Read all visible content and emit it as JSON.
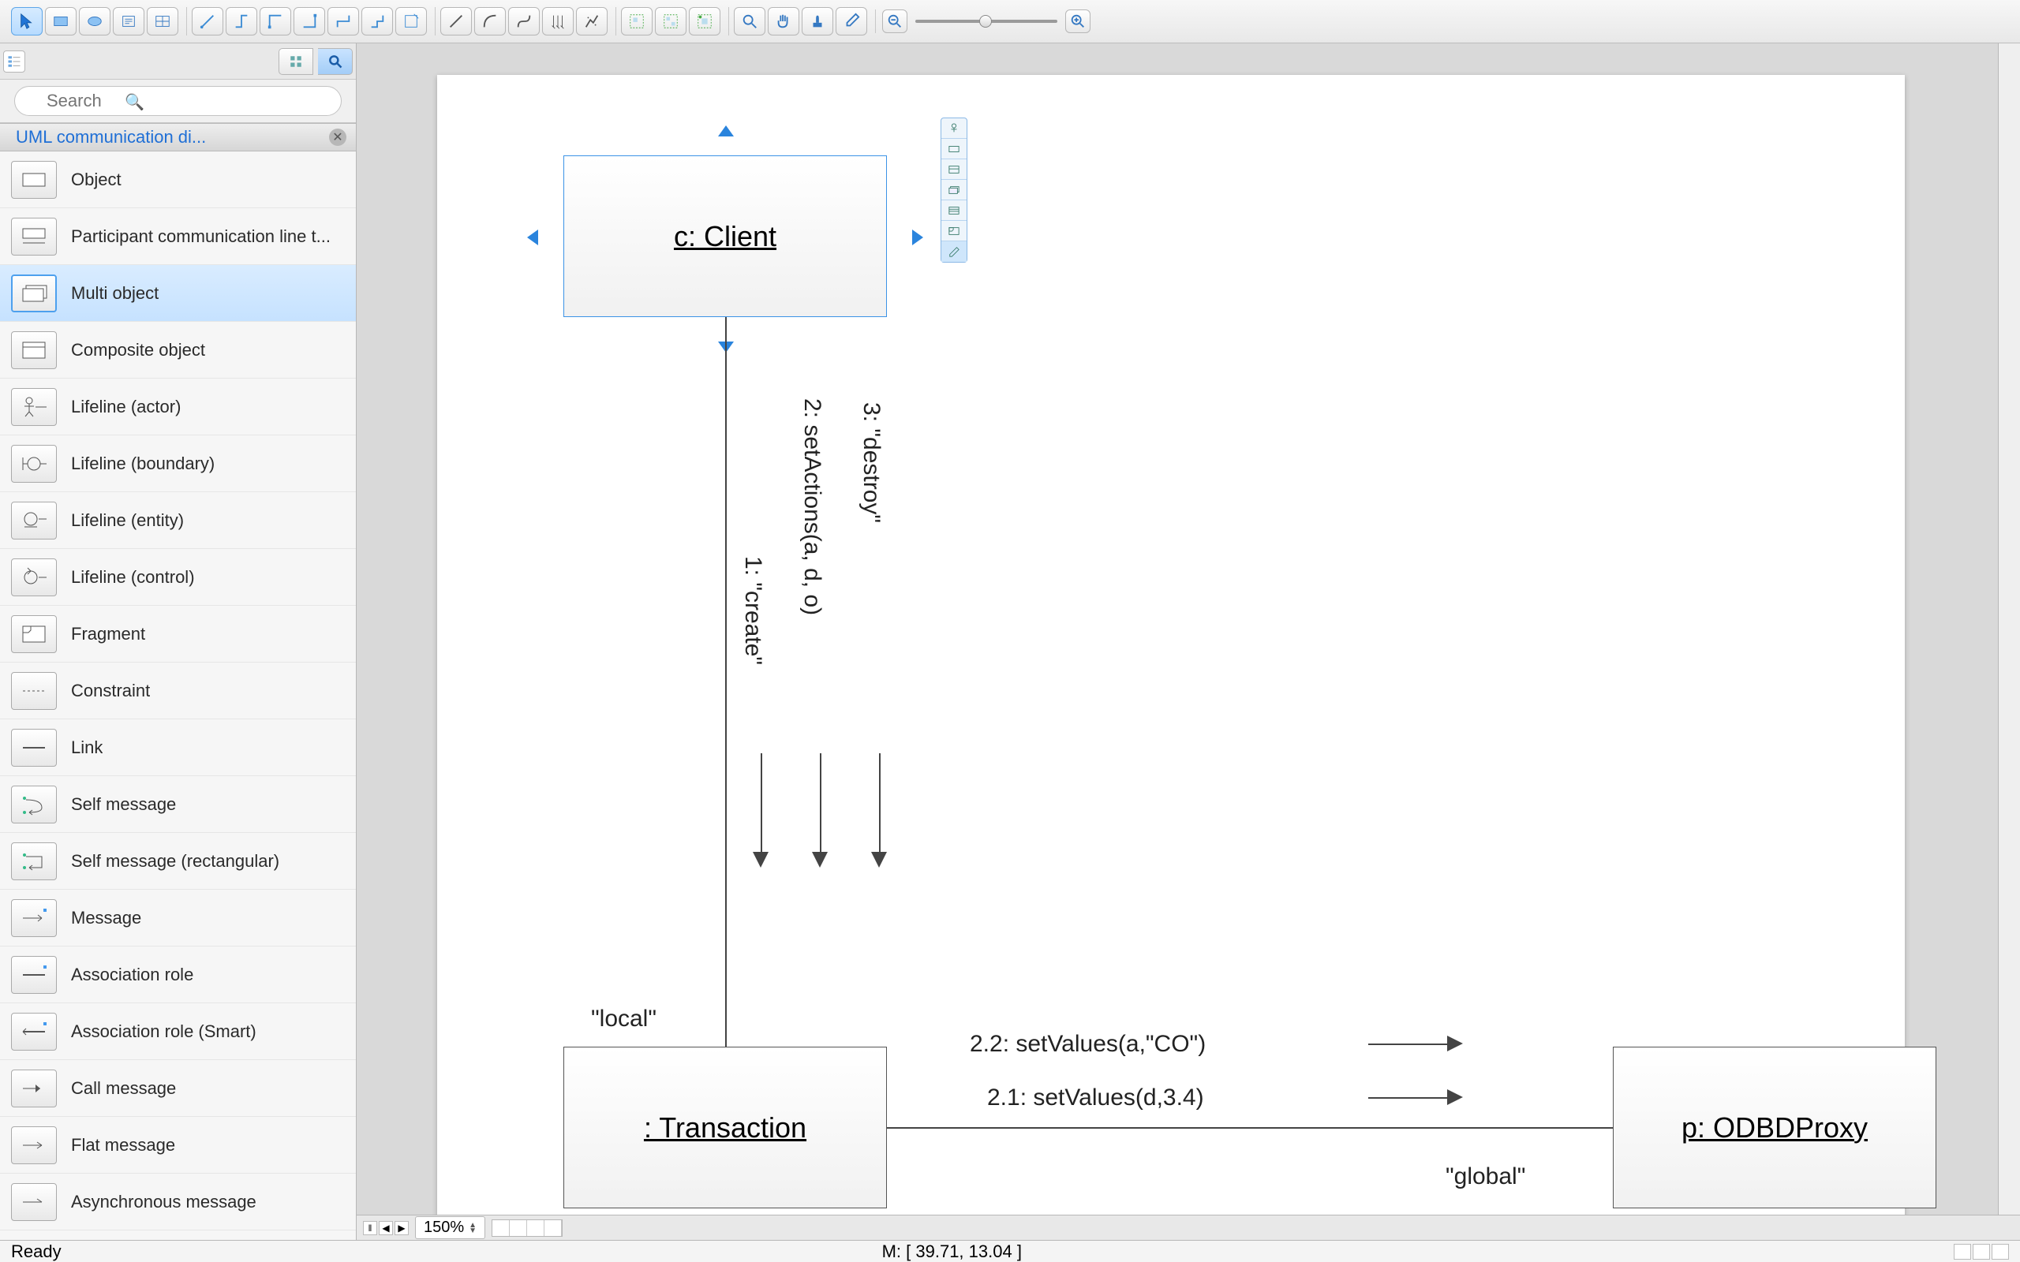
{
  "toolbar": {
    "selection": [
      "pointer",
      "rect",
      "ellipse",
      "text",
      "table"
    ],
    "connectors": [
      "conn1",
      "conn2",
      "conn3",
      "conn4",
      "conn5",
      "conn6",
      "conn7"
    ],
    "lines": [
      "l1",
      "l2",
      "l3",
      "l4",
      "l5"
    ],
    "group": [
      "g1",
      "g2",
      "g3"
    ],
    "view": [
      "zoom",
      "pan",
      "outline",
      "eyedrop"
    ]
  },
  "search": {
    "placeholder": "Search"
  },
  "section": {
    "title": "UML communication di..."
  },
  "palette": [
    {
      "id": "object",
      "label": "Object"
    },
    {
      "id": "participant",
      "label": "Participant communication line t..."
    },
    {
      "id": "multi-object",
      "label": "Multi object",
      "selected": true
    },
    {
      "id": "composite-object",
      "label": "Composite object"
    },
    {
      "id": "lifeline-actor",
      "label": "Lifeline (actor)"
    },
    {
      "id": "lifeline-boundary",
      "label": "Lifeline (boundary)"
    },
    {
      "id": "lifeline-entity",
      "label": "Lifeline (entity)"
    },
    {
      "id": "lifeline-control",
      "label": "Lifeline (control)"
    },
    {
      "id": "fragment",
      "label": "Fragment"
    },
    {
      "id": "constraint",
      "label": "Constraint"
    },
    {
      "id": "link",
      "label": "Link"
    },
    {
      "id": "self-message",
      "label": "Self message"
    },
    {
      "id": "self-message-rect",
      "label": "Self message (rectangular)"
    },
    {
      "id": "message",
      "label": "Message"
    },
    {
      "id": "association-role",
      "label": "Association role"
    },
    {
      "id": "association-role-smart",
      "label": "Association role (Smart)"
    },
    {
      "id": "call-message",
      "label": "Call message"
    },
    {
      "id": "flat-message",
      "label": "Flat message"
    },
    {
      "id": "async-message",
      "label": "Asynchronous message"
    }
  ],
  "diagram": {
    "client": "c: Client",
    "transaction": ": Transaction",
    "proxy": "p: ODBDProxy",
    "msg1": "1: \"create\"",
    "msg2": "2: setActions(a, d, o)",
    "msg3": "3: \"destroy\"",
    "local": "\"local\"",
    "global": "\"global\"",
    "msg21": "2.1: setValues(d,3.4)",
    "msg22": "2.2: setValues(a,\"CO\")"
  },
  "bottom": {
    "zoom": "150%"
  },
  "status": {
    "ready": "Ready",
    "coord": "M: [ 39.71, 13.04 ]"
  }
}
